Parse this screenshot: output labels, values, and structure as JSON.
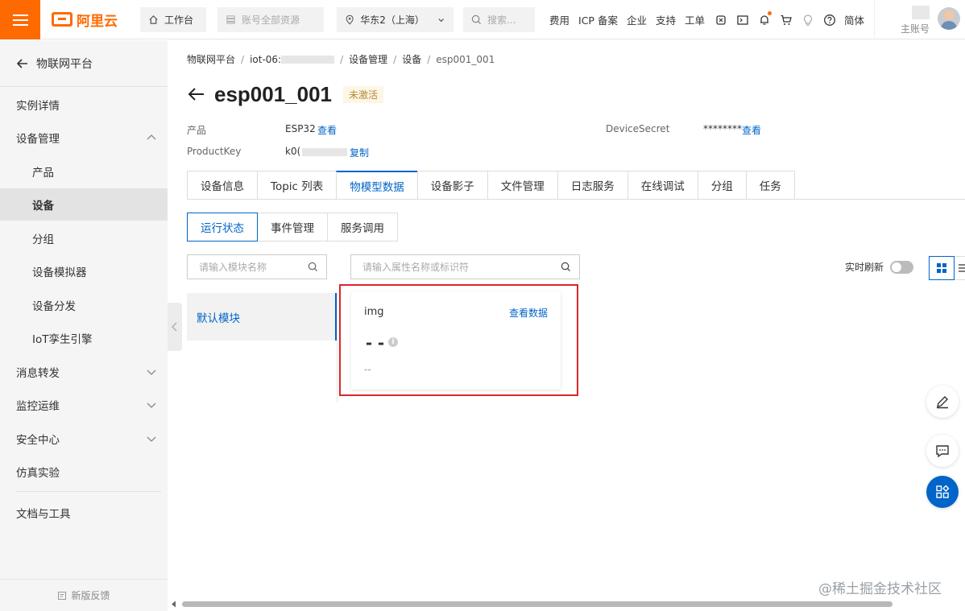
{
  "topbar": {
    "logo_text": "阿里云",
    "workbench": "工作台",
    "resources": "账号全部资源",
    "region": "华东2（上海）",
    "search_placeholder": "搜索...",
    "links": [
      "费用",
      "ICP 备案",
      "企业",
      "支持",
      "工单"
    ],
    "language": "简体",
    "account_label": "主账号",
    "icons": [
      "workbench-home-icon",
      "resource-icon",
      "location-pin-icon",
      "search-icon",
      "iot-chip-icon",
      "terminal-icon",
      "bell-icon",
      "cart-icon",
      "lightbulb-icon",
      "help-icon"
    ]
  },
  "sidebar": {
    "back_label": "物联网平台",
    "items": [
      {
        "label": "实例详情",
        "level": 0
      },
      {
        "label": "设备管理",
        "level": 0,
        "chevron": "up"
      },
      {
        "label": "产品",
        "level": 1
      },
      {
        "label": "设备",
        "level": 1,
        "active": true
      },
      {
        "label": "分组",
        "level": 1
      },
      {
        "label": "设备模拟器",
        "level": 1
      },
      {
        "label": "设备分发",
        "level": 1
      },
      {
        "label": "IoT孪生引擎",
        "level": 1
      },
      {
        "label": "消息转发",
        "level": 0,
        "chevron": "down"
      },
      {
        "label": "监控运维",
        "level": 0,
        "chevron": "down"
      },
      {
        "label": "安全中心",
        "level": 0,
        "chevron": "down"
      },
      {
        "label": "仿真实验",
        "level": 0
      },
      {
        "label": "文档与工具",
        "level": 0
      }
    ],
    "footer": "新版反馈"
  },
  "breadcrumb": {
    "items": [
      "物联网平台",
      "iot-06:",
      "设备管理",
      "设备",
      "esp001_001"
    ]
  },
  "device": {
    "name": "esp001_001",
    "status": "未激活",
    "product_label": "产品",
    "product_value": "ESP32",
    "product_link": "查看",
    "productkey_label": "ProductKey",
    "productkey_value": "k0(",
    "productkey_link": "复制",
    "secret_label": "DeviceSecret",
    "secret_value": "********",
    "secret_link": "查看"
  },
  "tabs": [
    "设备信息",
    "Topic 列表",
    "物模型数据",
    "设备影子",
    "文件管理",
    "日志服务",
    "在线调试",
    "分组",
    "任务"
  ],
  "active_tab": "物模型数据",
  "subtabs": [
    "运行状态",
    "事件管理",
    "服务调用"
  ],
  "active_subtab": "运行状态",
  "module_search_placeholder": "请输入模块名称",
  "property_search_placeholder": "请输入属性名称或标识符",
  "modules": [
    "默认模块"
  ],
  "realtime_label": "实时刷新",
  "property_card": {
    "name": "img",
    "link": "查看数据",
    "value": "--",
    "time": "--"
  },
  "watermark": "@稀土掘金技术社区",
  "colors": {
    "brand_orange": "#ff6a00",
    "accent_blue": "#0064c8",
    "highlight_red": "#d9262c"
  }
}
